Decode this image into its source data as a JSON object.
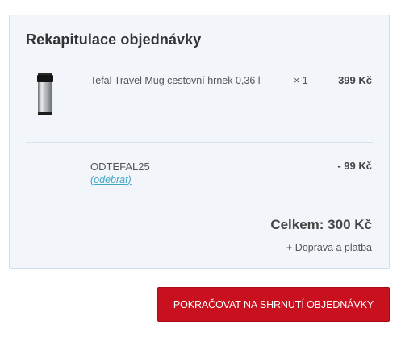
{
  "summary": {
    "title": "Rekapitulace objednávky",
    "items": [
      {
        "name": "Tefal Travel Mug cestovní hrnek 0,36 l",
        "quantity": "× 1",
        "price": "399 Kč",
        "thumbnail_icon": "travel-mug-icon"
      }
    ],
    "coupon": {
      "code": "ODTEFAL25",
      "remove_label": "(odebrat)",
      "discount": "- 99 Kč"
    },
    "total": "Celkem: 300 Kč",
    "shipping_note": "+ Doprava a platba"
  },
  "actions": {
    "continue_label": "POKRAČOVAT NA SHRNUTÍ OBJEDNÁVKY"
  },
  "colors": {
    "accent": "#c8101e",
    "link": "#3fa7c6",
    "panel_background": "#f2f6fb",
    "panel_border": "#d2deea"
  }
}
